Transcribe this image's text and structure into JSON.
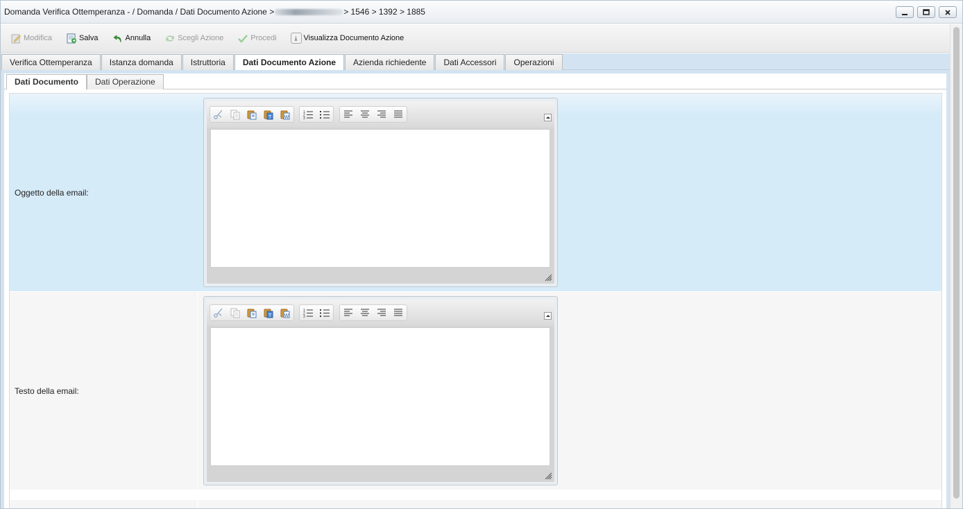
{
  "window": {
    "title_prefix": "Domanda Verifica Ottemperanza - / Domanda / Dati Documento Azione >",
    "title_suffix": "> 1546 > 1392 > 1885",
    "minimize_icon": "minimize-icon",
    "maximize_icon": "maximize-icon",
    "close_icon": "close-icon"
  },
  "toolbar": {
    "modifica": "Modifica",
    "salva": "Salva",
    "annulla": "Annulla",
    "scegli_azione": "Scegli Azione",
    "procedi": "Procedi",
    "visualizza": "Visualizza Documento Azione"
  },
  "main_tabs": [
    {
      "label": "Verifica Ottemperanza",
      "active": false
    },
    {
      "label": "Istanza domanda",
      "active": false
    },
    {
      "label": "Istruttoria",
      "active": false
    },
    {
      "label": "Dati Documento Azione",
      "active": true
    },
    {
      "label": "Azienda richiedente",
      "active": false
    },
    {
      "label": "Dati Accessori",
      "active": false
    },
    {
      "label": "Operazioni",
      "active": false
    }
  ],
  "sub_tabs": [
    {
      "label": "Dati Documento",
      "active": true
    },
    {
      "label": "Dati Operazione",
      "active": false
    }
  ],
  "form": {
    "oggetto_label": "Oggetto della email:",
    "oggetto_value": "",
    "testo_label": "Testo della email:",
    "testo_value": ""
  },
  "editor_tools": [
    "cut-icon",
    "copy-icon",
    "paste-icon",
    "paste-text-icon",
    "paste-word-icon",
    "ordered-list-icon",
    "unordered-list-icon",
    "align-left-icon",
    "align-center-icon",
    "align-right-icon",
    "justify-icon"
  ]
}
